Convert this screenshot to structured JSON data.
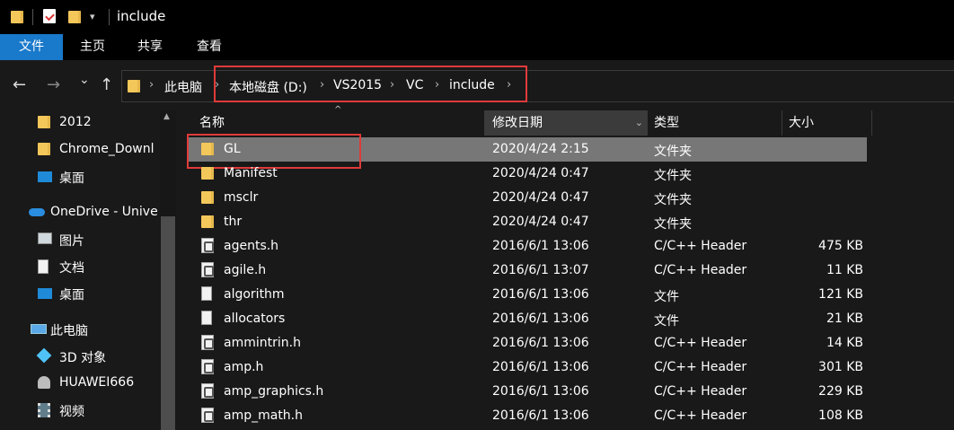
{
  "window": {
    "title": "include"
  },
  "ribbon": {
    "tabs": [
      "文件",
      "主页",
      "共享",
      "查看"
    ]
  },
  "nav": {
    "back": "←",
    "forward": "→",
    "recent": "⌄",
    "up": "↑",
    "breadcrumbs": [
      "此电脑",
      "本地磁盘 (D:)",
      "VS2015",
      "VC",
      "include"
    ]
  },
  "sidebar": {
    "items": [
      {
        "label": "2012",
        "icon": "folder-icon"
      },
      {
        "label": "Chrome_Downl",
        "icon": "folder-icon"
      },
      {
        "label": "桌面",
        "icon": "desktop-icon"
      },
      {
        "label": "OneDrive - Unive",
        "icon": "onedrive-icon"
      },
      {
        "label": "图片",
        "icon": "pictures-icon"
      },
      {
        "label": "文档",
        "icon": "documents-icon"
      },
      {
        "label": "桌面",
        "icon": "desktop-icon"
      },
      {
        "label": "此电脑",
        "icon": "this-pc-icon"
      },
      {
        "label": "3D 对象",
        "icon": "3d-objects-icon"
      },
      {
        "label": "HUAWEI666",
        "icon": "network-device-icon"
      },
      {
        "label": "视频",
        "icon": "videos-icon"
      }
    ]
  },
  "list": {
    "columns": {
      "name": "名称",
      "date": "修改日期",
      "type": "类型",
      "size": "大小"
    },
    "rows": [
      {
        "name": "GL",
        "date": "2020/4/24 2:15",
        "type": "文件夹",
        "size": "",
        "icon": "folder"
      },
      {
        "name": "Manifest",
        "date": "2020/4/24 0:47",
        "type": "文件夹",
        "size": "",
        "icon": "folder"
      },
      {
        "name": "msclr",
        "date": "2020/4/24 0:47",
        "type": "文件夹",
        "size": "",
        "icon": "folder"
      },
      {
        "name": "thr",
        "date": "2020/4/24 0:47",
        "type": "文件夹",
        "size": "",
        "icon": "folder"
      },
      {
        "name": "agents.h",
        "date": "2016/6/1 13:06",
        "type": "C/C++ Header",
        "size": "475 KB",
        "icon": "header"
      },
      {
        "name": "agile.h",
        "date": "2016/6/1 13:07",
        "type": "C/C++ Header",
        "size": "11 KB",
        "icon": "header"
      },
      {
        "name": "algorithm",
        "date": "2016/6/1 13:06",
        "type": "文件",
        "size": "121 KB",
        "icon": "file"
      },
      {
        "name": "allocators",
        "date": "2016/6/1 13:06",
        "type": "文件",
        "size": "21 KB",
        "icon": "file"
      },
      {
        "name": "ammintrin.h",
        "date": "2016/6/1 13:06",
        "type": "C/C++ Header",
        "size": "14 KB",
        "icon": "header"
      },
      {
        "name": "amp.h",
        "date": "2016/6/1 13:06",
        "type": "C/C++ Header",
        "size": "301 KB",
        "icon": "header"
      },
      {
        "name": "amp_graphics.h",
        "date": "2016/6/1 13:06",
        "type": "C/C++ Header",
        "size": "229 KB",
        "icon": "header"
      },
      {
        "name": "amp_math.h",
        "date": "2016/6/1 13:06",
        "type": "C/C++ Header",
        "size": "108 KB",
        "icon": "header"
      }
    ]
  }
}
